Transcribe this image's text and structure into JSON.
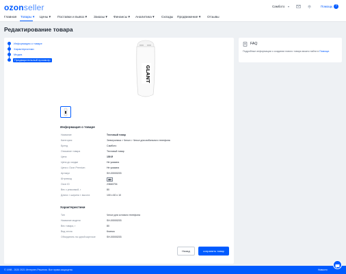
{
  "header": {
    "logo_primary": "ozon",
    "logo_secondary": "seller",
    "company": "Самбото",
    "help_label": "Помощь",
    "help_badge": "?"
  },
  "nav": {
    "items": [
      {
        "label": "Главная"
      },
      {
        "label": "Товары ▾",
        "active": true
      },
      {
        "label": "Цены ▾"
      },
      {
        "label": "Поставки и вывоз ▾"
      },
      {
        "label": "Заказы ▾"
      },
      {
        "label": "Финансы ▾"
      },
      {
        "label": "Аналитика ▾"
      },
      {
        "label": "Склады"
      },
      {
        "label": "Продвижение ▾"
      },
      {
        "label": "Отзывы"
      }
    ]
  },
  "page_title": "Редактирование товара",
  "steps": [
    {
      "label": "Информация о товаре"
    },
    {
      "label": "Характеристики"
    },
    {
      "label": "Медиа"
    },
    {
      "label": "Предварительный просмотр",
      "active": true
    }
  ],
  "product": {
    "image_icon": "car-charger-image",
    "image_text": "GLANT"
  },
  "info": {
    "title": "Информация о товаре",
    "rows": [
      {
        "label": "Название",
        "value": "Тестовый товар",
        "bold": true
      },
      {
        "label": "Категория",
        "value": "Электроника > Чехол > Чехол для мобильного телефона"
      },
      {
        "label": "Бренд",
        "value": "Самбото"
      },
      {
        "label": "Описание товара",
        "value": "Тестовый товар"
      },
      {
        "label": "Цена",
        "value": "150 ₽",
        "bold": true
      },
      {
        "label": "Цена до скидки",
        "value": "Не указана"
      },
      {
        "label": "Цена с Ozon Premium",
        "value": "Не указана"
      },
      {
        "label": "Артикул",
        "value": "SH-00000203"
      },
      {
        "label": "Штрихкод",
        "value": "",
        "barcode": true
      },
      {
        "label": "Ozon ID",
        "value": "23660794"
      },
      {
        "label": "Вес с упаковкой, г",
        "value": "80"
      },
      {
        "label": "Длина × ширина × высота",
        "value": "100 x 60 x 10"
      }
    ]
  },
  "specs": {
    "title": "Характеристики",
    "rows": [
      {
        "label": "Тип",
        "value": "Чехол для сотового телефона"
      },
      {
        "label": "Название модели",
        "value": "SH-00000203"
      },
      {
        "label": "Вес товара, г",
        "value": "80"
      },
      {
        "label": "Вид чехла",
        "value": "Клипса"
      },
      {
        "label": "Объединить на одной карточке",
        "value": "SH-00000203"
      }
    ]
  },
  "buttons": {
    "back": "Назад",
    "save": "сохранить товар"
  },
  "faq": {
    "title": "FAQ",
    "text": "Подробные информации о создании нового товара можно найти в ",
    "link": "Помощи."
  },
  "footer": {
    "copyright": "© 1998 - 2020 2021 Интернет-Решения. Все права защищены",
    "news": "Новости"
  },
  "colors": {
    "accent": "#005bff",
    "background": "#eef1f4"
  }
}
